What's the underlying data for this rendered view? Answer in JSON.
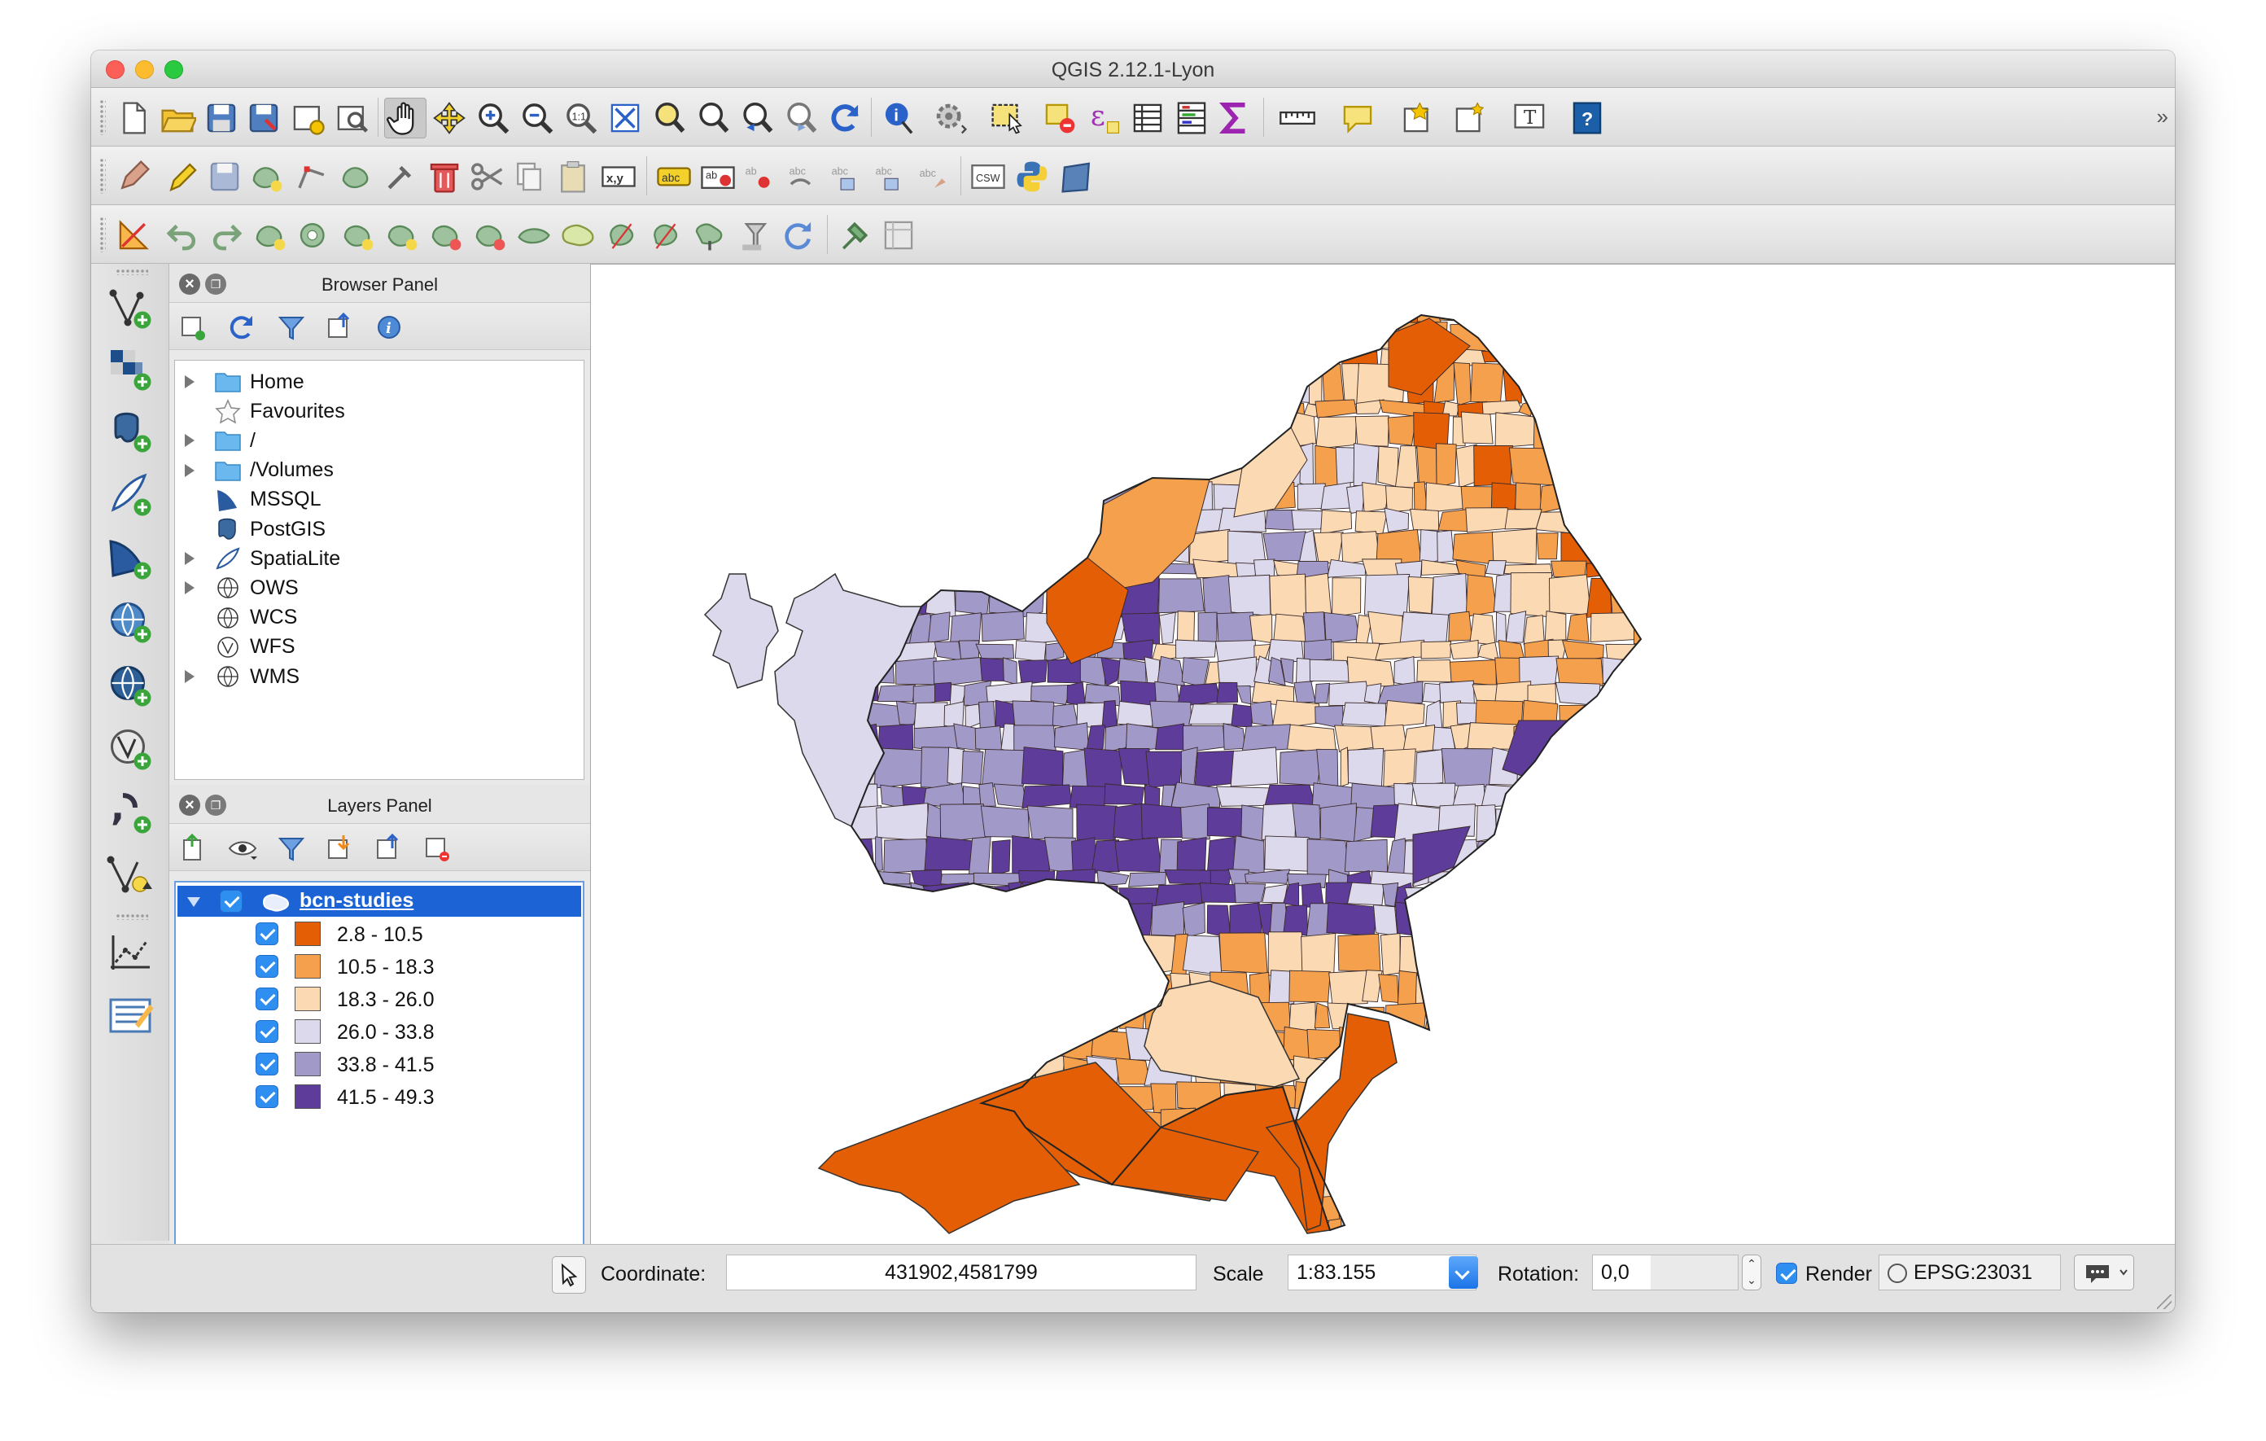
{
  "window": {
    "title": "QGIS 2.12.1-Lyon"
  },
  "toolbars": {
    "row1": [
      "new-project-icon",
      "open-project-icon",
      "save-project-icon",
      "save-as-icon",
      "new-print-composer-icon",
      "composer-manager-icon",
      "pan-icon",
      "pan-to-selection-icon",
      "zoom-in-icon",
      "zoom-out-icon",
      "zoom-actual-size-icon",
      "zoom-full-icon",
      "zoom-to-selection-icon",
      "zoom-to-layer-icon",
      "zoom-last-icon",
      "zoom-next-icon",
      "refresh-icon",
      "identify-icon",
      "run-action-icon",
      "select-features-icon",
      "deselect-icon",
      "field-calculator-icon",
      "attribute-table-icon",
      "statistical-summary-icon",
      "sum-icon",
      "measure-icon",
      "map-tips-icon",
      "new-bookmark-icon",
      "show-bookmarks-icon",
      "text-annotation-icon",
      "help-icon"
    ],
    "row2": [
      "current-edits-icon",
      "toggle-editing-icon",
      "save-edits-icon",
      "add-feature-icon",
      "node-tool-icon",
      "move-feature-icon",
      "edit-tool-icon",
      "delete-selected-icon",
      "cut-features-icon",
      "copy-features-icon",
      "paste-features-icon",
      "xy-icon",
      "label-icon",
      "pin-label-icon",
      "show-hide-labels-icon",
      "move-label-icon",
      "rotate-label-icon",
      "change-label-icon",
      "label-tool-icon",
      "csw-icon",
      "python-icon",
      "georeferencer-icon"
    ],
    "row3": [
      "digitize-icon",
      "undo-icon",
      "redo-icon",
      "add-ring-icon",
      "add-part-icon",
      "fill-ring-icon",
      "delete-ring-icon",
      "delete-part-icon",
      "reshape-icon",
      "offset-curve-icon",
      "simplify-icon",
      "split-features-icon",
      "split-parts-icon",
      "merge-features-icon",
      "merge-attributes-icon",
      "rotate-point-icon",
      "rotate-feature-icon",
      "tools-icon",
      "topology-icon"
    ],
    "xy_label": "x,y",
    "csw_label": "CSW",
    "more": "»"
  },
  "left_toolbar": [
    "add-vector-layer-icon",
    "add-raster-layer-icon",
    "add-postgis-layer-icon",
    "add-spatialite-layer-icon",
    "add-mssql-layer-icon",
    "add-wms-layer-icon",
    "add-wcs-layer-icon",
    "add-wfs-layer-icon",
    "add-delimited-text-icon",
    "new-layer-icon",
    "gps-tools-icon",
    "text-editor-icon"
  ],
  "browser_panel": {
    "title": "Browser Panel",
    "tools": [
      "add-selected-layer-icon",
      "refresh-icon",
      "filter-icon",
      "collapse-all-icon",
      "properties-icon"
    ],
    "items": [
      {
        "label": "Home",
        "icon": "folder-icon",
        "expandable": true
      },
      {
        "label": "Favourites",
        "icon": "star-icon",
        "expandable": false
      },
      {
        "label": "/",
        "icon": "folder-icon",
        "expandable": true
      },
      {
        "label": "/Volumes",
        "icon": "folder-icon",
        "expandable": true
      },
      {
        "label": "MSSQL",
        "icon": "mssql-icon",
        "expandable": false
      },
      {
        "label": "PostGIS",
        "icon": "postgis-icon",
        "expandable": false
      },
      {
        "label": "SpatiaLite",
        "icon": "spatialite-icon",
        "expandable": true
      },
      {
        "label": "OWS",
        "icon": "globe-icon",
        "expandable": true
      },
      {
        "label": "WCS",
        "icon": "globe-icon",
        "expandable": false
      },
      {
        "label": "WFS",
        "icon": "wfs-icon",
        "expandable": false
      },
      {
        "label": "WMS",
        "icon": "globe-icon",
        "expandable": true
      }
    ]
  },
  "layers_panel": {
    "title": "Layers Panel",
    "tools": [
      "open-layer-styling-icon",
      "manage-visibility-icon",
      "filter-legend-icon",
      "expand-all-icon",
      "collapse-all-icon",
      "remove-layer-icon"
    ],
    "layer": {
      "name": "bcn-studies",
      "checked": true
    },
    "legend": [
      {
        "label": "2.8 - 10.5",
        "color": "#e35e04",
        "checked": true
      },
      {
        "label": "10.5 - 18.3",
        "color": "#f5a04c",
        "checked": true
      },
      {
        "label": "18.3 - 26.0",
        "color": "#fad9b3",
        "checked": true
      },
      {
        "label": "26.0 - 33.8",
        "color": "#dbd9eb",
        "checked": true
      },
      {
        "label": "33.8 - 41.5",
        "color": "#a19ac9",
        "checked": true
      },
      {
        "label": "41.5 - 49.3",
        "color": "#5e3c99",
        "checked": true
      }
    ]
  },
  "statusbar": {
    "coordinate_label": "Coordinate:",
    "coordinate_value": "431902,4581799",
    "scale_label": "Scale",
    "scale_value": "1:83.155",
    "rotation_label": "Rotation:",
    "rotation_value": "0,0",
    "render_label": "Render",
    "render_checked": true,
    "crs": "EPSG:23031"
  }
}
